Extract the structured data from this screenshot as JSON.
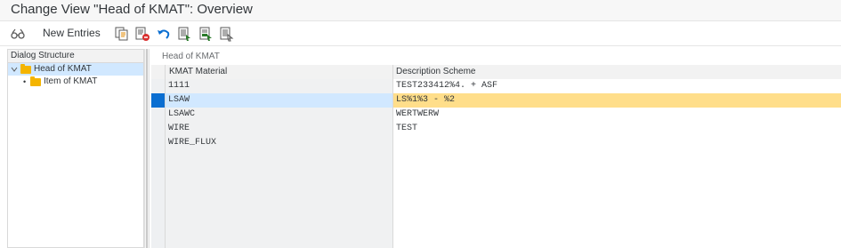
{
  "window": {
    "title": "Change View \"Head of KMAT\": Overview"
  },
  "toolbar": {
    "new_entries_label": "New Entries",
    "icons": [
      "glasses-icon",
      "copy-icon",
      "delete-icon",
      "undo-icon",
      "select-all-icon",
      "select-block-icon",
      "deselect-all-icon"
    ]
  },
  "dialog_structure": {
    "header": "Dialog Structure",
    "items": [
      {
        "label": "Head of KMAT",
        "selected": true
      },
      {
        "label": "Item of KMAT",
        "selected": false
      }
    ]
  },
  "main": {
    "section_title": "Head of KMAT",
    "columns": [
      "KMAT Material",
      "Description Scheme"
    ],
    "rows": [
      {
        "material": "1111",
        "description": "TEST233412%4. + ASF"
      },
      {
        "material": "LSAW",
        "description": "LS%1%3 - %2"
      },
      {
        "material": "LSAWC",
        "description": "WERTWERW"
      },
      {
        "material": "WIRE",
        "description": "TEST"
      },
      {
        "material": "WIRE_FLUX",
        "description": ""
      }
    ],
    "active_row": 1,
    "empty_rows": 7
  },
  "colors": {
    "selected_row_cell": "#ffde8a",
    "selected_row_key": "#d1e8ff",
    "row_selector_active": "#0a6ed1",
    "folder": "#f4b400"
  }
}
